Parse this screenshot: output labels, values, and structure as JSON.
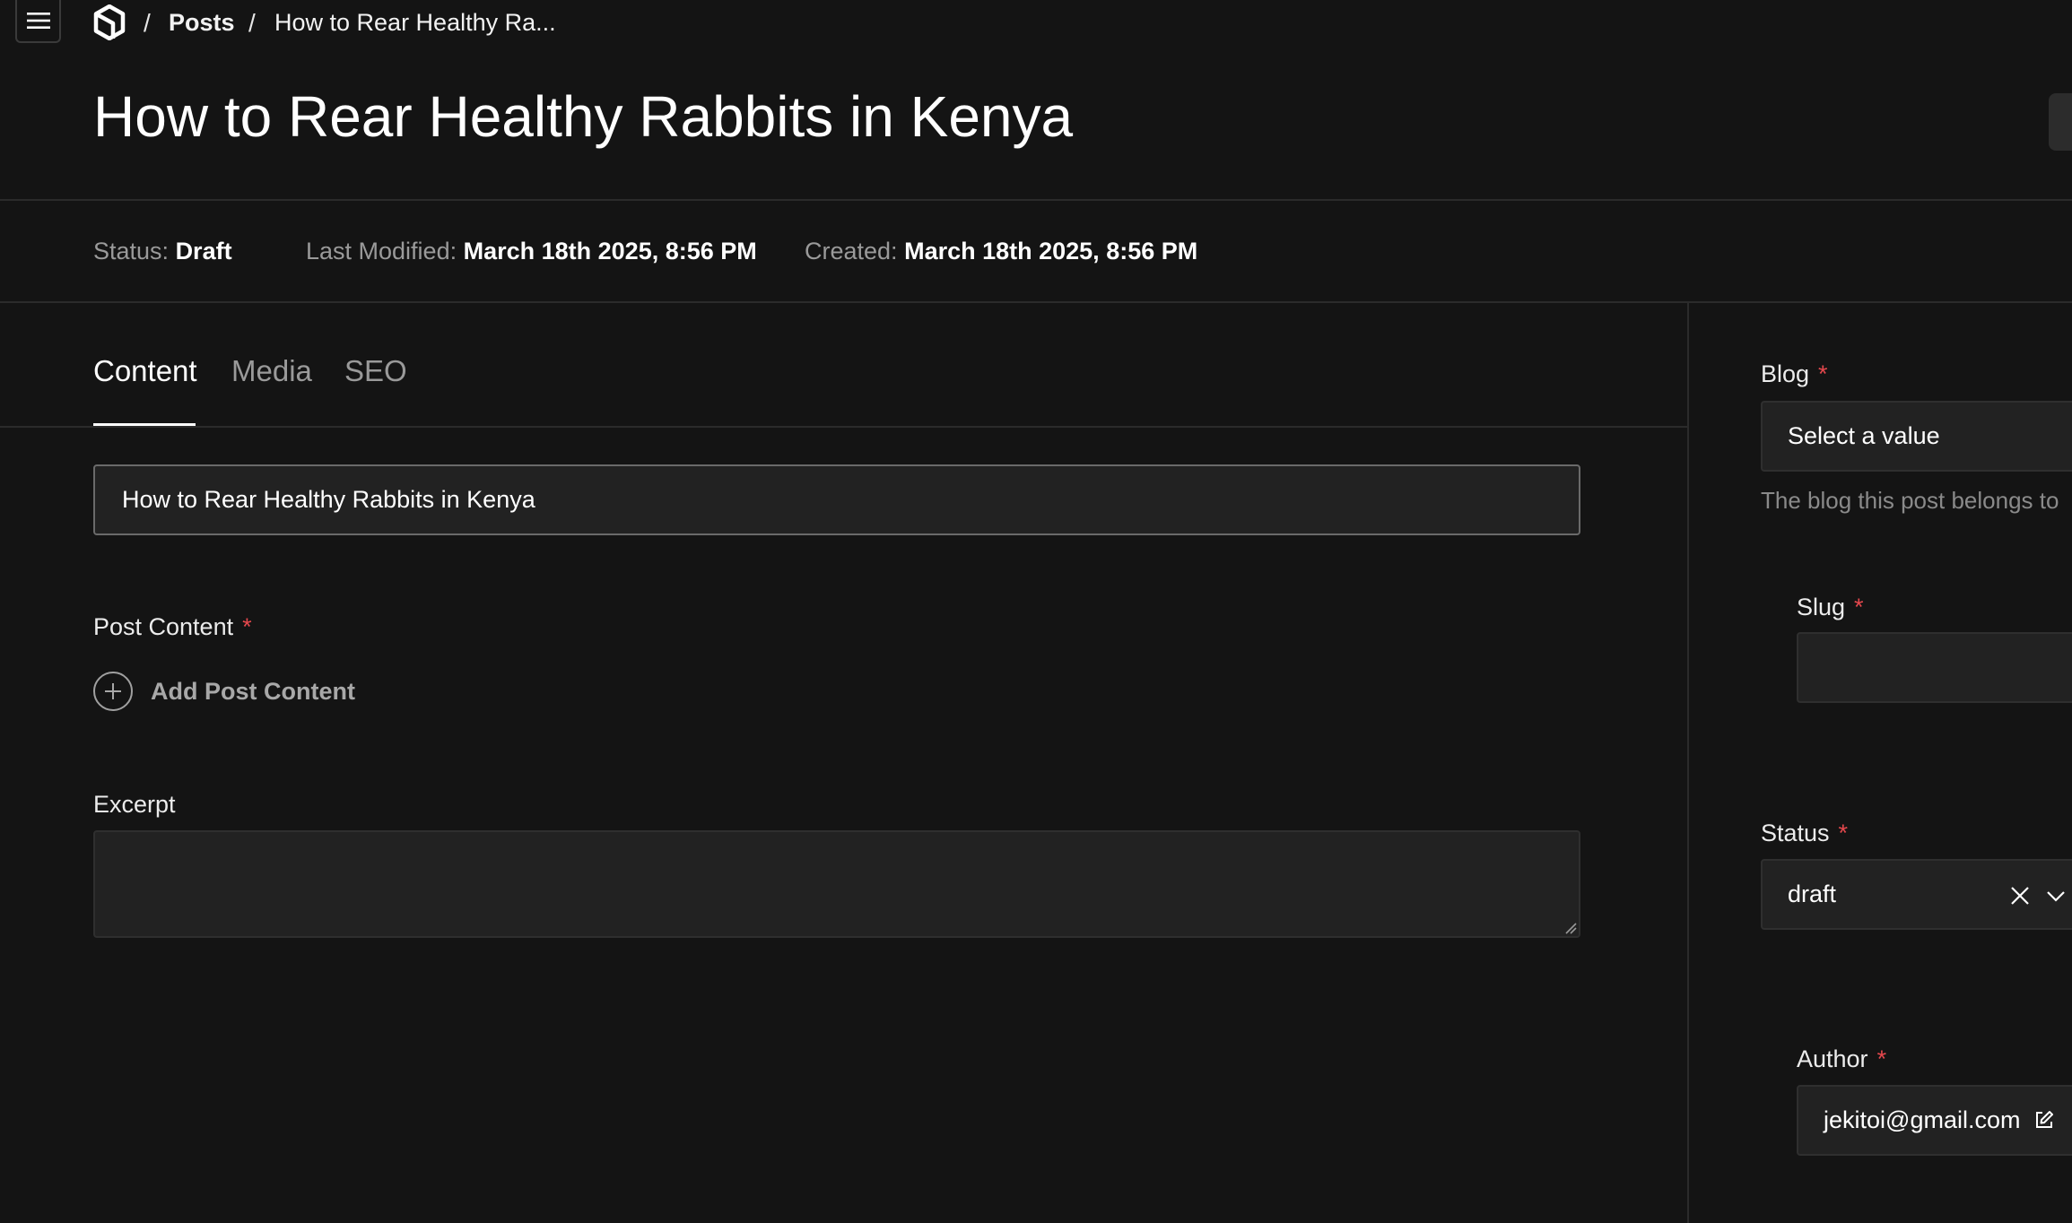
{
  "breadcrumb": {
    "separator": "/",
    "items": [
      {
        "label": "Posts"
      },
      {
        "label": "How to Rear Healthy Ra..."
      }
    ]
  },
  "icons": {
    "menu": "hamburger-menu-icon",
    "logo": "app-logo-icon",
    "add": "plus-circle-icon",
    "clear": "close-icon",
    "dropdown": "chevron-down-icon",
    "edit": "edit-icon",
    "resize": "resize-grip-icon"
  },
  "page": {
    "title": "How to Rear Healthy Rabbits in Kenya"
  },
  "meta": {
    "status_label": "Status:",
    "status_value": "Draft",
    "modified_label": "Last Modified:",
    "modified_value": "March 18th 2025, 8:56 PM",
    "created_label": "Created:",
    "created_value": "March 18th 2025, 8:56 PM"
  },
  "tabs": [
    {
      "label": "Content",
      "active": true
    },
    {
      "label": "Media",
      "active": false
    },
    {
      "label": "SEO",
      "active": false
    }
  ],
  "form": {
    "title_value": "How to Rear Healthy Rabbits in Kenya",
    "required_mark": "*",
    "post_content_label": "Post Content",
    "add_post_content_label": "Add Post Content",
    "excerpt_label": "Excerpt",
    "excerpt_value": ""
  },
  "sidebar": {
    "blog_label": "Blog",
    "blog_placeholder": "Select a value",
    "blog_description": "The blog this post belongs to",
    "slug_label": "Slug",
    "slug_value": "",
    "status_label": "Status",
    "status_value": "draft",
    "author_label": "Author",
    "author_value": "jekitoi@gmail.com"
  },
  "colors": {
    "background": "#141414",
    "input_background": "#222222",
    "required": "#e5484d",
    "muted_text": "#9a9a9a"
  }
}
